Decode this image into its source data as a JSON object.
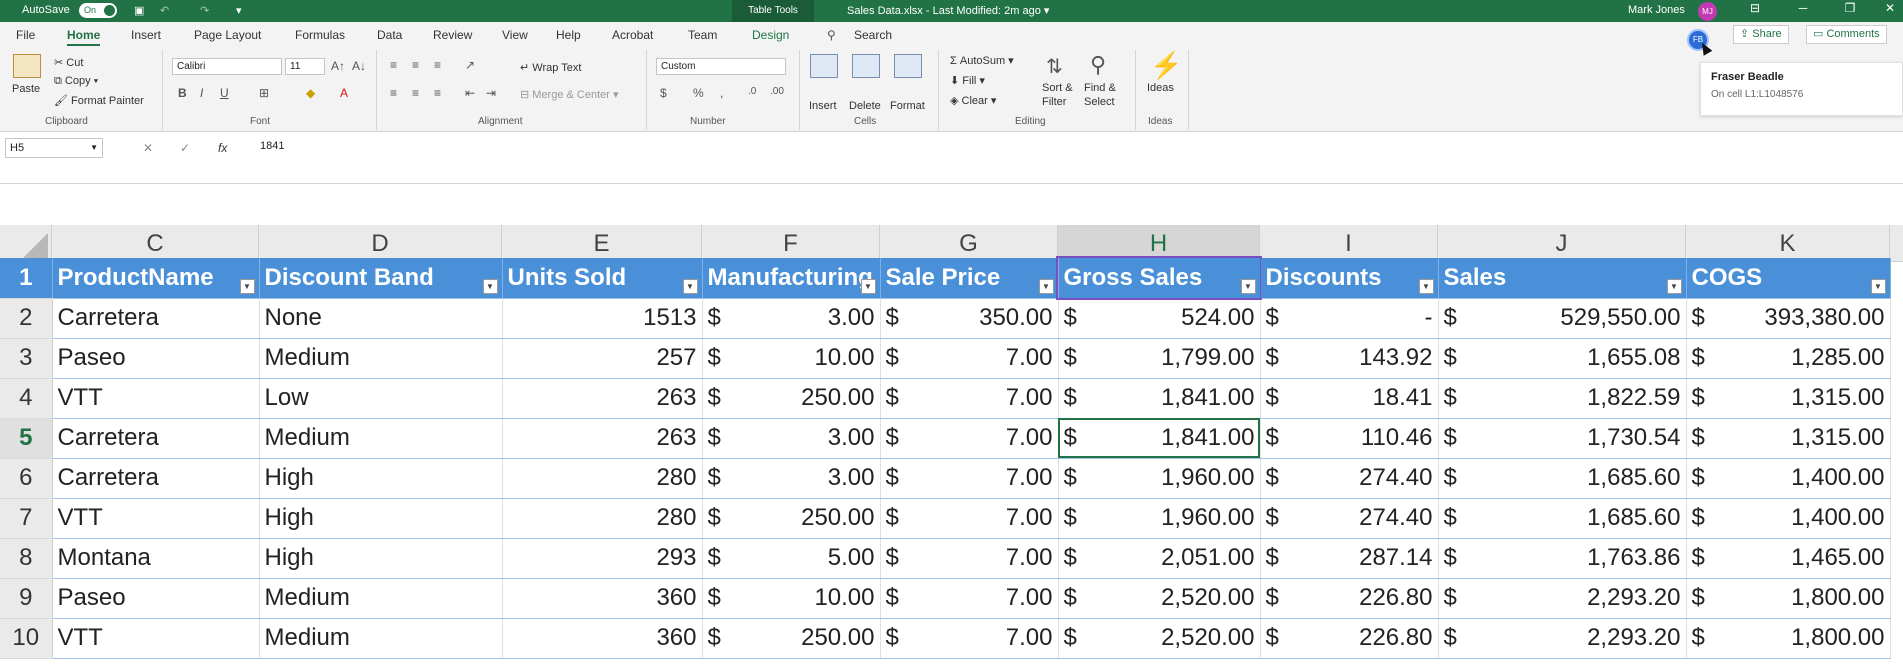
{
  "titlebar": {
    "autosave_label": "AutoSave",
    "autosave_state": "On",
    "table_tools": "Table Tools",
    "file_title": "Sales Data.xlsx  -  Last Modified: 2m ago",
    "user_name": "Mark Jones",
    "user_initials": "MJ"
  },
  "menu": {
    "tabs": [
      "File",
      "Home",
      "Insert",
      "Page Layout",
      "Formulas",
      "Data",
      "Review",
      "View",
      "Help",
      "Acrobat",
      "Team",
      "Design"
    ],
    "search": "Search",
    "share": "Share",
    "comments": "Comments"
  },
  "collaborator": {
    "initials": "FB",
    "name": "Fraser Beadle",
    "location": "On cell L1:L1048576"
  },
  "ribbon": {
    "clipboard": {
      "paste": "Paste",
      "cut": "Cut",
      "copy": "Copy",
      "format_painter": "Format Painter",
      "group": "Clipboard"
    },
    "font": {
      "family": "Calibri",
      "size": "11",
      "group": "Font"
    },
    "alignment": {
      "wrap": "Wrap Text",
      "merge": "Merge & Center",
      "group": "Alignment"
    },
    "number": {
      "format": "Custom",
      "group": "Number"
    },
    "cells": {
      "insert": "Insert",
      "delete": "Delete",
      "format": "Format",
      "group": "Cells"
    },
    "editing": {
      "autosum": "AutoSum",
      "fill": "Fill",
      "clear": "Clear",
      "sort": "Sort &",
      "sort2": "Filter",
      "find": "Find &",
      "find2": "Select",
      "group": "Editing"
    },
    "ideas": {
      "label": "Ideas",
      "group": "Ideas"
    }
  },
  "formula_bar": {
    "name_box": "H5",
    "value": "1841"
  },
  "columns": [
    "C",
    "D",
    "E",
    "F",
    "G",
    "H",
    "I",
    "J",
    "K"
  ],
  "selected_column": "H",
  "headers": [
    "ProductName",
    "Discount Band",
    "Units Sold",
    "Manufacturing",
    "Sale Price",
    "Gross Sales",
    "Discounts",
    "Sales",
    "COGS"
  ],
  "rows": [
    {
      "n": "2",
      "c": [
        "Carretera",
        "None",
        "1513",
        "3.00",
        "350.00",
        "524.00",
        "-",
        "529,550.00",
        "393,380.00"
      ]
    },
    {
      "n": "3",
      "c": [
        "Paseo",
        "Medium",
        "257",
        "10.00",
        "7.00",
        "1,799.00",
        "143.92",
        "1,655.08",
        "1,285.00"
      ]
    },
    {
      "n": "4",
      "c": [
        "VTT",
        "Low",
        "263",
        "250.00",
        "7.00",
        "1,841.00",
        "18.41",
        "1,822.59",
        "1,315.00"
      ]
    },
    {
      "n": "5",
      "c": [
        "Carretera",
        "Medium",
        "263",
        "3.00",
        "7.00",
        "1,841.00",
        "110.46",
        "1,730.54",
        "1,315.00"
      ]
    },
    {
      "n": "6",
      "c": [
        "Carretera",
        "High",
        "280",
        "3.00",
        "7.00",
        "1,960.00",
        "274.40",
        "1,685.60",
        "1,400.00"
      ]
    },
    {
      "n": "7",
      "c": [
        "VTT",
        "High",
        "280",
        "250.00",
        "7.00",
        "1,960.00",
        "274.40",
        "1,685.60",
        "1,400.00"
      ]
    },
    {
      "n": "8",
      "c": [
        "Montana",
        "High",
        "293",
        "5.00",
        "7.00",
        "2,051.00",
        "287.14",
        "1,763.86",
        "1,465.00"
      ]
    },
    {
      "n": "9",
      "c": [
        "Paseo",
        "Medium",
        "360",
        "10.00",
        "7.00",
        "2,520.00",
        "226.80",
        "2,293.20",
        "1,800.00"
      ]
    },
    {
      "n": "10",
      "c": [
        "VTT",
        "Medium",
        "360",
        "250.00",
        "7.00",
        "2,520.00",
        "226.80",
        "2,293.20",
        "1,800.00"
      ]
    }
  ],
  "currency_symbol": "$"
}
